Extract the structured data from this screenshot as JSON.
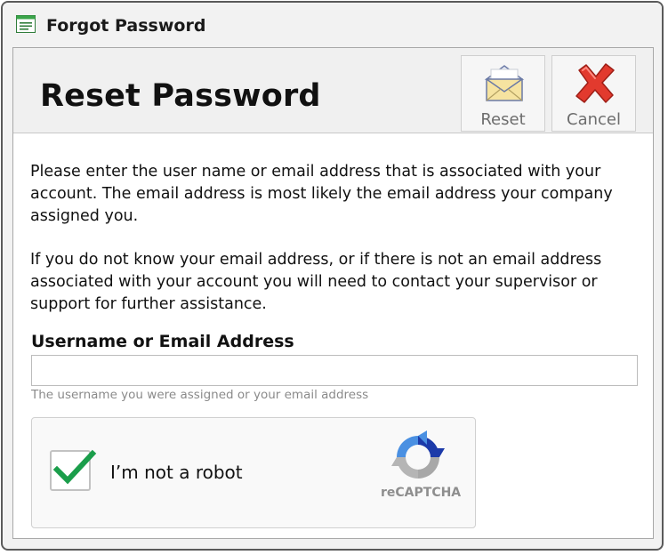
{
  "window": {
    "title": "Forgot Password",
    "icon": "app-window-icon"
  },
  "header": {
    "heading": "Reset Password",
    "buttons": {
      "reset": {
        "label": "Reset",
        "icon": "envelope-icon"
      },
      "cancel": {
        "label": "Cancel",
        "icon": "red-x-icon"
      }
    }
  },
  "body": {
    "paragraph1": "Please enter the user name or email address that is associated with your account. The email address is most likely the email address your company assigned you.",
    "paragraph2": "If you do not know your email address, or if there is not an email address associated with your account you will need to contact your supervisor or support for further assistance."
  },
  "form": {
    "label": "Username or Email Address",
    "value": "",
    "hint": "The username you were assigned or your email address"
  },
  "captcha": {
    "checked": true,
    "label": "I’m not a robot",
    "brand": "reCAPTCHA",
    "colors": {
      "check": "#1b9e4b",
      "blue": "#4a90e2",
      "gray": "#b5b5b5"
    }
  }
}
